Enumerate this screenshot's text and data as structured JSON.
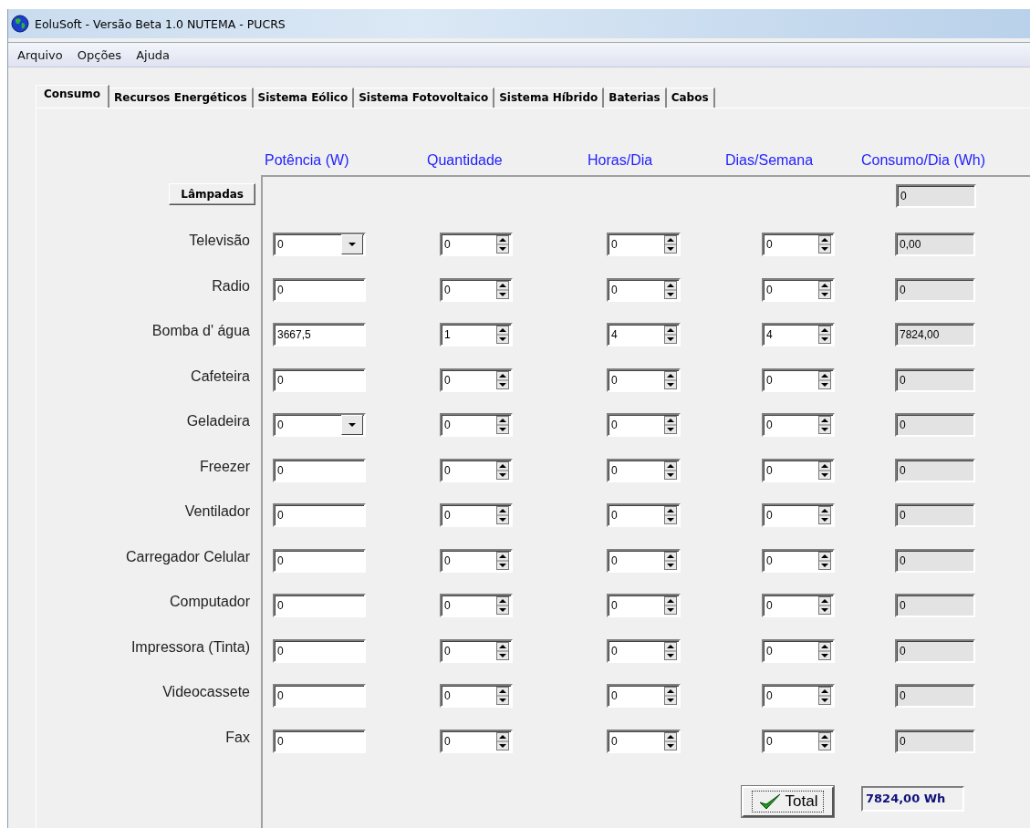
{
  "window": {
    "title": "EoluSoft - Versão Beta 1.0  NUTEMA - PUCRS"
  },
  "menu": [
    "Arquivo",
    "Opções",
    "Ajuda"
  ],
  "tabs": [
    {
      "label": "Consumo",
      "selected": true
    },
    {
      "label": "Recursos Energéticos",
      "selected": false
    },
    {
      "label": "Sistema Eólico",
      "selected": false
    },
    {
      "label": "Sistema Fotovoltaico",
      "selected": false
    },
    {
      "label": "Sistema Híbrido",
      "selected": false
    },
    {
      "label": "Baterias",
      "selected": false
    },
    {
      "label": "Cabos",
      "selected": false
    }
  ],
  "columns": [
    "Potência (W)",
    "Quantidade",
    "Horas/Dia",
    "Dias/Semana",
    "Consumo/Dia (Wh)"
  ],
  "rows": [
    {
      "kind": "button",
      "label": "Lâmpadas",
      "consumption": "0"
    },
    {
      "kind": "combo",
      "label": "Televisão",
      "power": "0",
      "quantity": "0",
      "hours": "0",
      "days": "0",
      "consumption": "0,00"
    },
    {
      "kind": "text",
      "label": "Radio",
      "power": "0",
      "quantity": "0",
      "hours": "0",
      "days": "0",
      "consumption": "0"
    },
    {
      "kind": "text",
      "label": "Bomba d' água",
      "power": "3667,5",
      "quantity": "1",
      "hours": "4",
      "days": "4",
      "consumption": "7824,00"
    },
    {
      "kind": "text",
      "label": "Cafeteira",
      "power": "0",
      "quantity": "0",
      "hours": "0",
      "days": "0",
      "consumption": "0"
    },
    {
      "kind": "combo",
      "label": "Geladeira",
      "power": "0",
      "quantity": "0",
      "hours": "0",
      "days": "0",
      "consumption": "0"
    },
    {
      "kind": "text",
      "label": "Freezer",
      "power": "0",
      "quantity": "0",
      "hours": "0",
      "days": "0",
      "consumption": "0"
    },
    {
      "kind": "text",
      "label": "Ventilador",
      "power": "0",
      "quantity": "0",
      "hours": "0",
      "days": "0",
      "consumption": "0"
    },
    {
      "kind": "text",
      "label": "Carregador Celular",
      "power": "0",
      "quantity": "0",
      "hours": "0",
      "days": "0",
      "consumption": "0"
    },
    {
      "kind": "text",
      "label": "Computador",
      "power": "0",
      "quantity": "0",
      "hours": "0",
      "days": "0",
      "consumption": "0"
    },
    {
      "kind": "text",
      "label": "Impressora (Tinta)",
      "power": "0",
      "quantity": "0",
      "hours": "0",
      "days": "0",
      "consumption": "0"
    },
    {
      "kind": "text",
      "label": "Videocassete",
      "power": "0",
      "quantity": "0",
      "hours": "0",
      "days": "0",
      "consumption": "0"
    },
    {
      "kind": "text",
      "label": "Fax",
      "power": "0",
      "quantity": "0",
      "hours": "0",
      "days": "0",
      "consumption": "0"
    }
  ],
  "total": {
    "button": "Total",
    "value": "7824,00 Wh"
  }
}
